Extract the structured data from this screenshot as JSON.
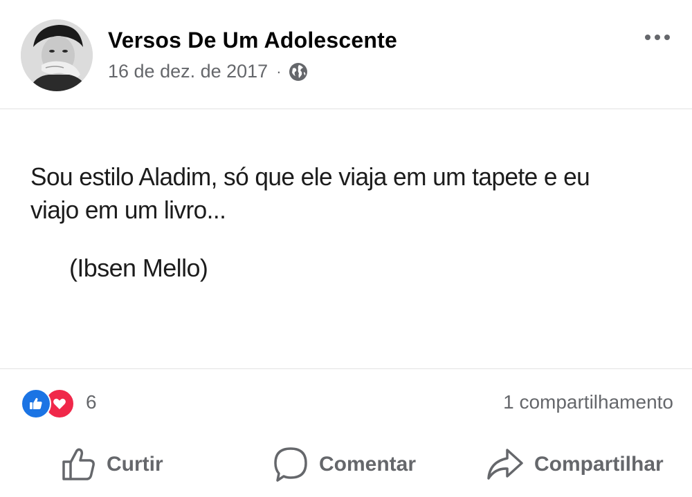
{
  "post": {
    "author": "Versos De Um Adolescente",
    "date": "16 de dez. de 2017",
    "separator": "·",
    "privacy_icon": "globe-icon",
    "more_icon": "more-options-icon"
  },
  "content": {
    "quote": "Sou estilo Aladim, só que ele viaja em um tapete e eu viajo em um livro...",
    "attribution": "(Ibsen Mello)"
  },
  "reactions": {
    "icons": [
      "like-reaction-icon",
      "love-reaction-icon"
    ],
    "count": "6",
    "shares": "1 compartilhamento"
  },
  "actions": {
    "like_label": "Curtir",
    "comment_label": "Comentar",
    "share_label": "Compartilhar"
  },
  "colors": {
    "like_blue": "#1b74e4",
    "love_red": "#f0284a",
    "secondary_text": "#65676b"
  }
}
